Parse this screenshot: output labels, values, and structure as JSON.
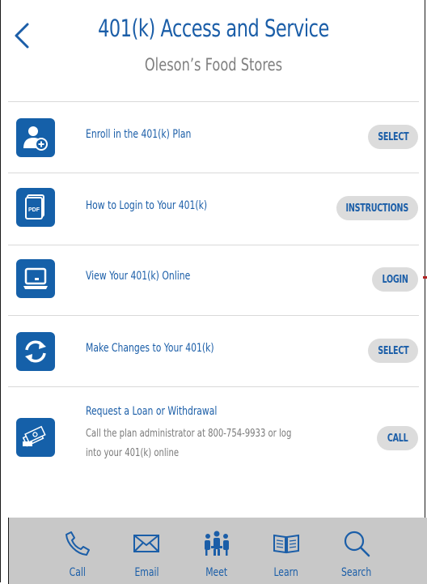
{
  "header": {
    "title": "401(k) Access and Service",
    "subtitle": "Oleson’s Food Stores"
  },
  "colors": {
    "brand_blue": "#1560a9",
    "text_blue": "#1b5ea8",
    "pill_gray": "#dcdcdc",
    "tabbar_gray": "#c8c8c8"
  },
  "rows": [
    {
      "icon": "user-add-icon",
      "label": "Enroll in the 401(k) Plan",
      "button": "SELECT"
    },
    {
      "icon": "pdf-document-icon",
      "label": "How to Login to Your 401(k)",
      "button": "INSTRUCTIONS"
    },
    {
      "icon": "laptop-icon",
      "label": "View Your 401(k) Online",
      "button": "LOGIN"
    },
    {
      "icon": "refresh-icon",
      "label": "Make Changes to Your 401(k)",
      "button": "SELECT"
    },
    {
      "icon": "money-transfer-icon",
      "label": "Request a Loan or Withdrawal",
      "description": "Call the plan administrator at 800-754-9933 or log into your 401(k) online",
      "button": "CALL"
    }
  ],
  "tabs": [
    {
      "icon": "phone-icon",
      "label": "Call"
    },
    {
      "icon": "envelope-icon",
      "label": "Email"
    },
    {
      "icon": "group-meet-icon",
      "label": "Meet"
    },
    {
      "icon": "book-icon",
      "label": "Learn"
    },
    {
      "icon": "search-icon",
      "label": "Search"
    }
  ]
}
